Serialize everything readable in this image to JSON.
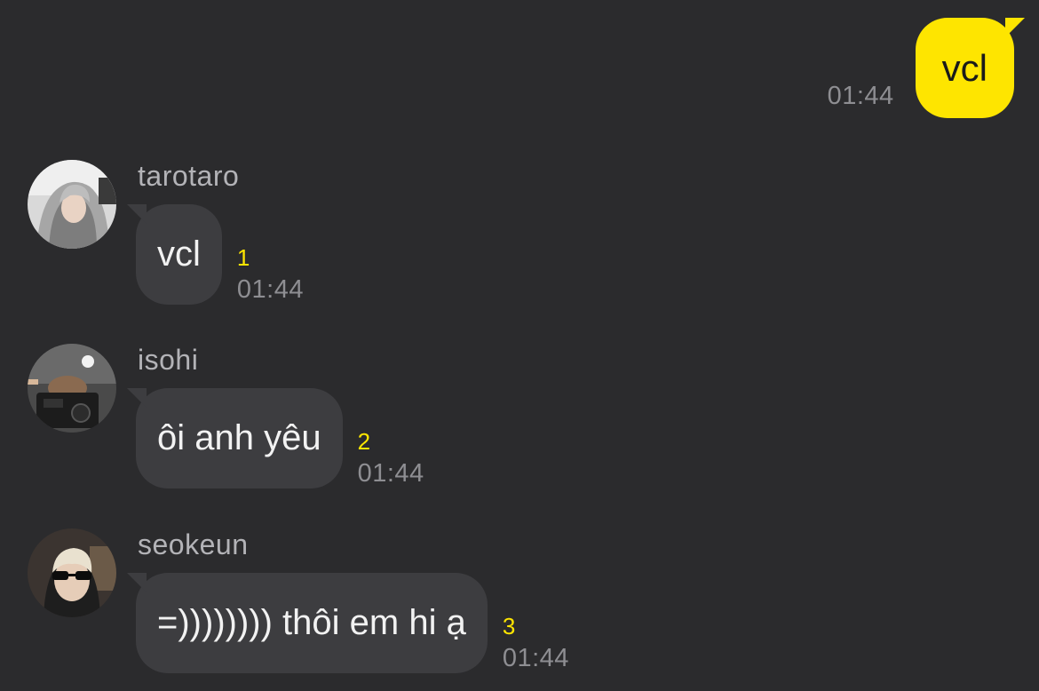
{
  "theme": {
    "background": "#2b2b2d",
    "outgoing_bubble": "#fee500",
    "incoming_bubble": "#3d3d40",
    "unread_color": "#fee500"
  },
  "outgoing": {
    "text": "vcl",
    "time": "01:44"
  },
  "messages": [
    {
      "sender": "tarotaro",
      "text": "vcl",
      "unread": "1",
      "time": "01:44",
      "avatar_icon": "avatar-photo-hoodie"
    },
    {
      "sender": "isohi",
      "text": "ôi anh yêu",
      "unread": "2",
      "time": "01:44",
      "avatar_icon": "avatar-photo-camera"
    },
    {
      "sender": "seokeun",
      "text": "=)))))))) thôi em hi ạ",
      "unread": "3",
      "time": "01:44",
      "avatar_icon": "avatar-photo-sunglasses"
    }
  ]
}
